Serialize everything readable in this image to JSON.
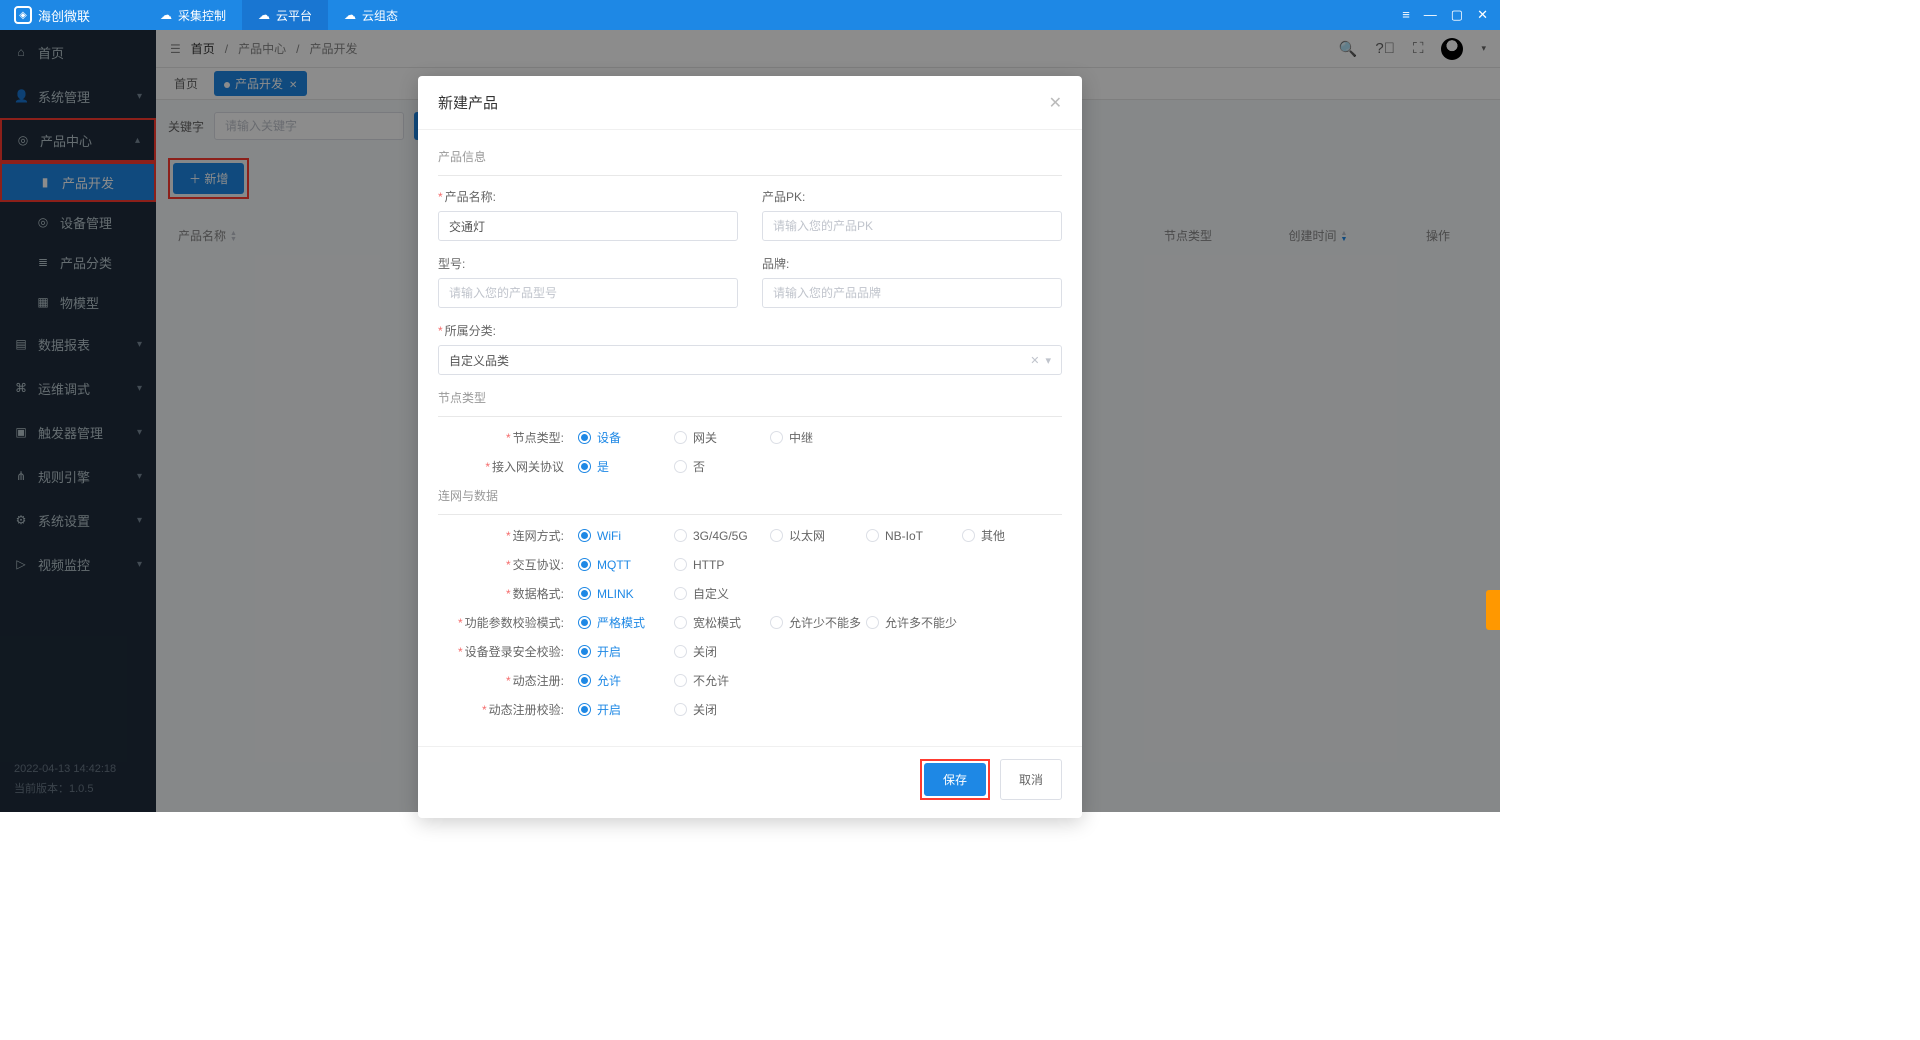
{
  "titlebar": {
    "brand": "海创微联",
    "tabs": [
      "采集控制",
      "云平台",
      "云组态"
    ],
    "active_tab": 1
  },
  "sidebar": {
    "items": [
      {
        "label": "首页",
        "icon": "home"
      },
      {
        "label": "系统管理",
        "icon": "user",
        "chevron": true
      },
      {
        "label": "产品中心",
        "icon": "target",
        "chevron": true,
        "highlighted": true,
        "children": [
          {
            "label": "产品开发",
            "icon": "folder",
            "active": true,
            "highlighted": true
          },
          {
            "label": "设备管理",
            "icon": "target"
          },
          {
            "label": "产品分类",
            "icon": "list"
          },
          {
            "label": "物模型",
            "icon": "grid"
          }
        ]
      },
      {
        "label": "数据报表",
        "icon": "chart",
        "chevron": true
      },
      {
        "label": "运维调式",
        "icon": "wrench",
        "chevron": true
      },
      {
        "label": "触发器管理",
        "icon": "bell",
        "chevron": true
      },
      {
        "label": "规则引擎",
        "icon": "flow",
        "chevron": true
      },
      {
        "label": "系统设置",
        "icon": "gear",
        "chevron": true
      },
      {
        "label": "视频监控",
        "icon": "camera",
        "chevron": true
      }
    ],
    "footer_time": "2022-04-13 14:42:18",
    "footer_version": "当前版本：1.0.5"
  },
  "breadcrumb": {
    "home": "首页",
    "parts": [
      "产品中心",
      "产品开发"
    ]
  },
  "page_tabs": {
    "home": "首页",
    "active": "产品开发"
  },
  "toolbar": {
    "keyword_label": "关键字",
    "keyword_placeholder": "请输入关键字",
    "add_btn": "＋ 新增"
  },
  "table": {
    "cols": [
      "产品名称",
      "节点类型",
      "创建时间",
      "操作"
    ]
  },
  "modal": {
    "title": "新建产品",
    "section_info": "产品信息",
    "fields": {
      "name_label": "产品名称:",
      "name_value": "交通灯",
      "pk_label": "产品PK:",
      "pk_placeholder": "请输入您的产品PK",
      "model_label": "型号:",
      "model_placeholder": "请输入您的产品型号",
      "brand_label": "品牌:",
      "brand_placeholder": "请输入您的产品品牌",
      "category_label": "所属分类:",
      "category_value": "自定义品类"
    },
    "section_node": "节点类型",
    "node_type": {
      "label": "节点类型:",
      "options": [
        "设备",
        "网关",
        "中继"
      ],
      "selected": 0
    },
    "gateway_proto": {
      "label": "接入网关协议",
      "options": [
        "是",
        "否"
      ],
      "selected": 0
    },
    "section_net": "连网与数据",
    "net_way": {
      "label": "连网方式:",
      "options": [
        "WiFi",
        "3G/4G/5G",
        "以太网",
        "NB-IoT",
        "其他"
      ],
      "selected": 0
    },
    "proto": {
      "label": "交互协议:",
      "options": [
        "MQTT",
        "HTTP"
      ],
      "selected": 0
    },
    "data_fmt": {
      "label": "数据格式:",
      "options": [
        "MLINK",
        "自定义"
      ],
      "selected": 0
    },
    "param_mode": {
      "label": "功能参数校验模式:",
      "options": [
        "严格模式",
        "宽松模式",
        "允许少不能多",
        "允许多不能少"
      ],
      "selected": 0
    },
    "login_sec": {
      "label": "设备登录安全校验:",
      "options": [
        "开启",
        "关闭"
      ],
      "selected": 0
    },
    "dyn_reg": {
      "label": "动态注册:",
      "options": [
        "允许",
        "不允许"
      ],
      "selected": 0
    },
    "dyn_reg_check": {
      "label": "动态注册校验:",
      "options": [
        "开启",
        "关闭"
      ],
      "selected": 0
    },
    "save": "保存",
    "cancel": "取消"
  }
}
